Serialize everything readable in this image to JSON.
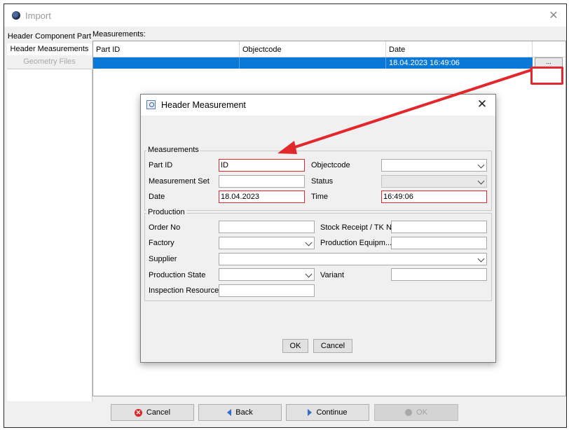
{
  "window": {
    "title": "Import",
    "close_label": "✕"
  },
  "nav": {
    "items": [
      {
        "label": "Header Component Part"
      },
      {
        "label": "Header Measurements"
      },
      {
        "label": "Geometry Files"
      }
    ]
  },
  "measurements": {
    "label": "Measurements:",
    "columns": [
      "Part ID",
      "Objectcode",
      "Date"
    ],
    "rows": [
      {
        "part_id": "",
        "objectcode": "",
        "date": "18.04.2023 16:49:06"
      }
    ],
    "row_button_label": "..."
  },
  "bottom_buttons": {
    "cancel": "Cancel",
    "back": "Back",
    "continue": "Continue",
    "ok": "OK"
  },
  "dialog": {
    "title": "Header Measurement",
    "close_label": "✕",
    "measurements_group": {
      "legend": "Measurements",
      "part_id_label": "Part ID",
      "part_id_value": "ID",
      "objectcode_label": "Objectcode",
      "objectcode_value": "",
      "measurement_set_label": "Measurement Set",
      "measurement_set_value": "",
      "status_label": "Status",
      "status_value": "",
      "date_label": "Date",
      "date_value": "18.04.2023",
      "time_label": "Time",
      "time_value": "16:49:06"
    },
    "production_group": {
      "legend": "Production",
      "order_no_label": "Order No",
      "stock_receipt_label": "Stock Receipt / TK N...",
      "factory_label": "Factory",
      "production_equipment_label": "Production Equipm...",
      "supplier_label": "Supplier",
      "production_state_label": "Production State",
      "variant_label": "Variant",
      "inspection_resource_label": "Inspection Resource"
    },
    "ok_label": "OK",
    "cancel_label": "Cancel"
  },
  "colors": {
    "selection": "#0a78d7",
    "annotation_red": "#e3282d"
  }
}
